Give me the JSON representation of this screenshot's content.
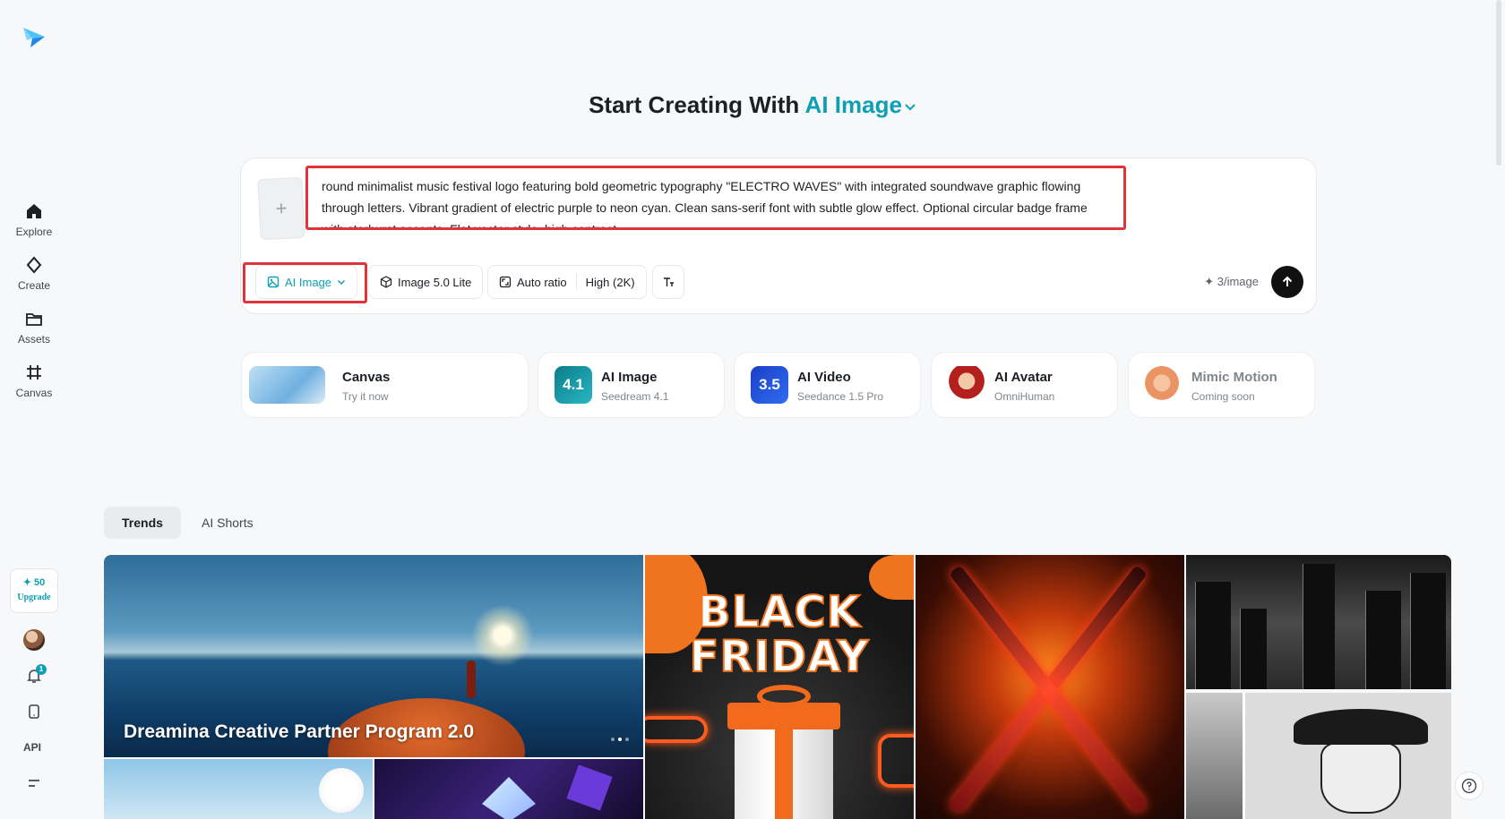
{
  "sidebar": {
    "items": [
      {
        "label": "Explore",
        "icon": "home-icon"
      },
      {
        "label": "Create",
        "icon": "diamond-icon"
      },
      {
        "label": "Assets",
        "icon": "folder-icon"
      },
      {
        "label": "Canvas",
        "icon": "hash-frame-icon"
      }
    ],
    "credits": "✦ 50",
    "upgrade": "Upgrade",
    "notification_count": "1",
    "api": "API"
  },
  "header": {
    "title_prefix": "Start Creating With",
    "title_mode": "AI Image"
  },
  "prompt": {
    "text": "round minimalist music festival logo featuring bold geometric typography \"ELECTRO WAVES\" with integrated soundwave graphic flowing through letters. Vibrant gradient of electric purple to neon cyan. Clean sans-serif font with subtle glow effect. Optional circular badge frame with starburst accents. Flat vector style, high contrast",
    "add_symbol": "+"
  },
  "toolbar": {
    "mode": "AI Image",
    "model": "Image 5.0 Lite",
    "ratio": "Auto ratio",
    "quality": "High (2K)",
    "cost": "✦ 3/image"
  },
  "tools": [
    {
      "name": "Canvas",
      "sub": "Try it now"
    },
    {
      "name": "AI Image",
      "sub": "Seedream 4.1",
      "badge": "4.1"
    },
    {
      "name": "AI Video",
      "sub": "Seedance 1.5 Pro",
      "badge": "3.5"
    },
    {
      "name": "AI Avatar",
      "sub": "OmniHuman"
    },
    {
      "name": "Mimic Motion",
      "sub": "Coming soon"
    }
  ],
  "tabs": [
    {
      "label": "Trends",
      "active": true
    },
    {
      "label": "AI Shorts",
      "active": false
    }
  ],
  "gallery": {
    "featured_caption": "Dreamina Creative Partner Program 2.0",
    "black_friday_line1": "BLACK",
    "black_friday_line2": "FRIDAY"
  },
  "colors": {
    "accent": "#0e9fb5",
    "annotation_red": "#e0343b"
  }
}
